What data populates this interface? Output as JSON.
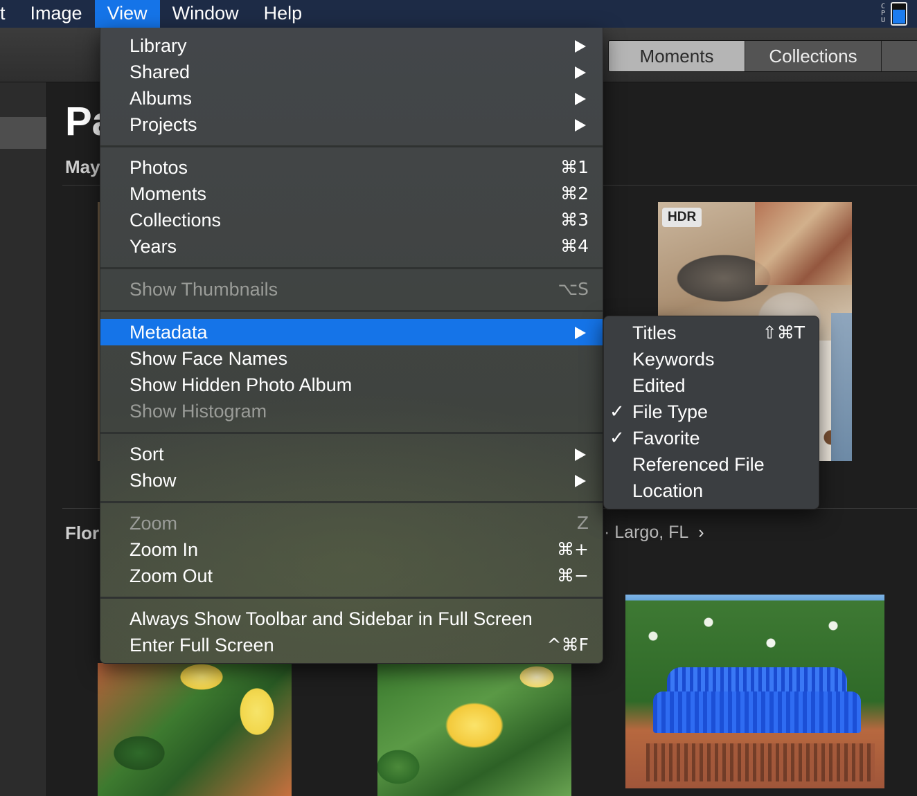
{
  "menubar": {
    "items": [
      "t",
      "Image",
      "View",
      "Window",
      "Help"
    ],
    "active": "View",
    "cpu_label": "CPU"
  },
  "toolbar": {
    "segments": [
      {
        "label": "Moments",
        "selected": true
      },
      {
        "label": "Collections",
        "selected": false
      }
    ]
  },
  "content": {
    "page_title": "Pa",
    "section1_label": "May",
    "section2_label": "Flor",
    "location": "Largo, FL",
    "location_chevron": "›",
    "hdr_badge": "HDR"
  },
  "view_menu": {
    "items": [
      {
        "label": "Library",
        "shortcut": "",
        "submenu": true,
        "disabled": false
      },
      {
        "label": "Shared",
        "shortcut": "",
        "submenu": true,
        "disabled": false
      },
      {
        "label": "Albums",
        "shortcut": "",
        "submenu": true,
        "disabled": false
      },
      {
        "label": "Projects",
        "shortcut": "",
        "submenu": true,
        "disabled": false
      },
      {
        "label": "Photos",
        "shortcut": "⌘1",
        "submenu": false,
        "disabled": false
      },
      {
        "label": "Moments",
        "shortcut": "⌘2",
        "submenu": false,
        "disabled": false
      },
      {
        "label": "Collections",
        "shortcut": "⌘3",
        "submenu": false,
        "disabled": false
      },
      {
        "label": "Years",
        "shortcut": "⌘4",
        "submenu": false,
        "disabled": false
      },
      {
        "label": "Show Thumbnails",
        "shortcut": "⌥S",
        "submenu": false,
        "disabled": true
      },
      {
        "label": "Metadata",
        "shortcut": "",
        "submenu": true,
        "disabled": false,
        "highlighted": true
      },
      {
        "label": "Show Face Names",
        "shortcut": "",
        "submenu": false,
        "disabled": false
      },
      {
        "label": "Show Hidden Photo Album",
        "shortcut": "",
        "submenu": false,
        "disabled": false
      },
      {
        "label": "Show Histogram",
        "shortcut": "",
        "submenu": false,
        "disabled": true
      },
      {
        "label": "Sort",
        "shortcut": "",
        "submenu": true,
        "disabled": false
      },
      {
        "label": "Show",
        "shortcut": "",
        "submenu": true,
        "disabled": false
      },
      {
        "label": "Zoom",
        "shortcut": "Z",
        "submenu": false,
        "disabled": true
      },
      {
        "label": "Zoom In",
        "shortcut": "⌘+",
        "submenu": false,
        "disabled": false
      },
      {
        "label": "Zoom Out",
        "shortcut": "⌘−",
        "submenu": false,
        "disabled": false
      },
      {
        "label": "Always Show Toolbar and Sidebar in Full Screen",
        "shortcut": "",
        "submenu": false,
        "disabled": false
      },
      {
        "label": "Enter Full Screen",
        "shortcut": "^⌘F",
        "submenu": false,
        "disabled": false
      }
    ]
  },
  "metadata_submenu": {
    "items": [
      {
        "label": "Titles",
        "shortcut": "⇧⌘T",
        "checked": false
      },
      {
        "label": "Keywords",
        "shortcut": "",
        "checked": false
      },
      {
        "label": "Edited",
        "shortcut": "",
        "checked": false
      },
      {
        "label": "File Type",
        "shortcut": "",
        "checked": true
      },
      {
        "label": "Favorite",
        "shortcut": "",
        "checked": true
      },
      {
        "label": "Referenced File",
        "shortcut": "",
        "checked": false
      },
      {
        "label": "Location",
        "shortcut": "",
        "checked": false
      }
    ],
    "check_glyph": "✓"
  },
  "colors": {
    "menubar_bg": "#1d2b46",
    "highlight": "#1574e8"
  }
}
